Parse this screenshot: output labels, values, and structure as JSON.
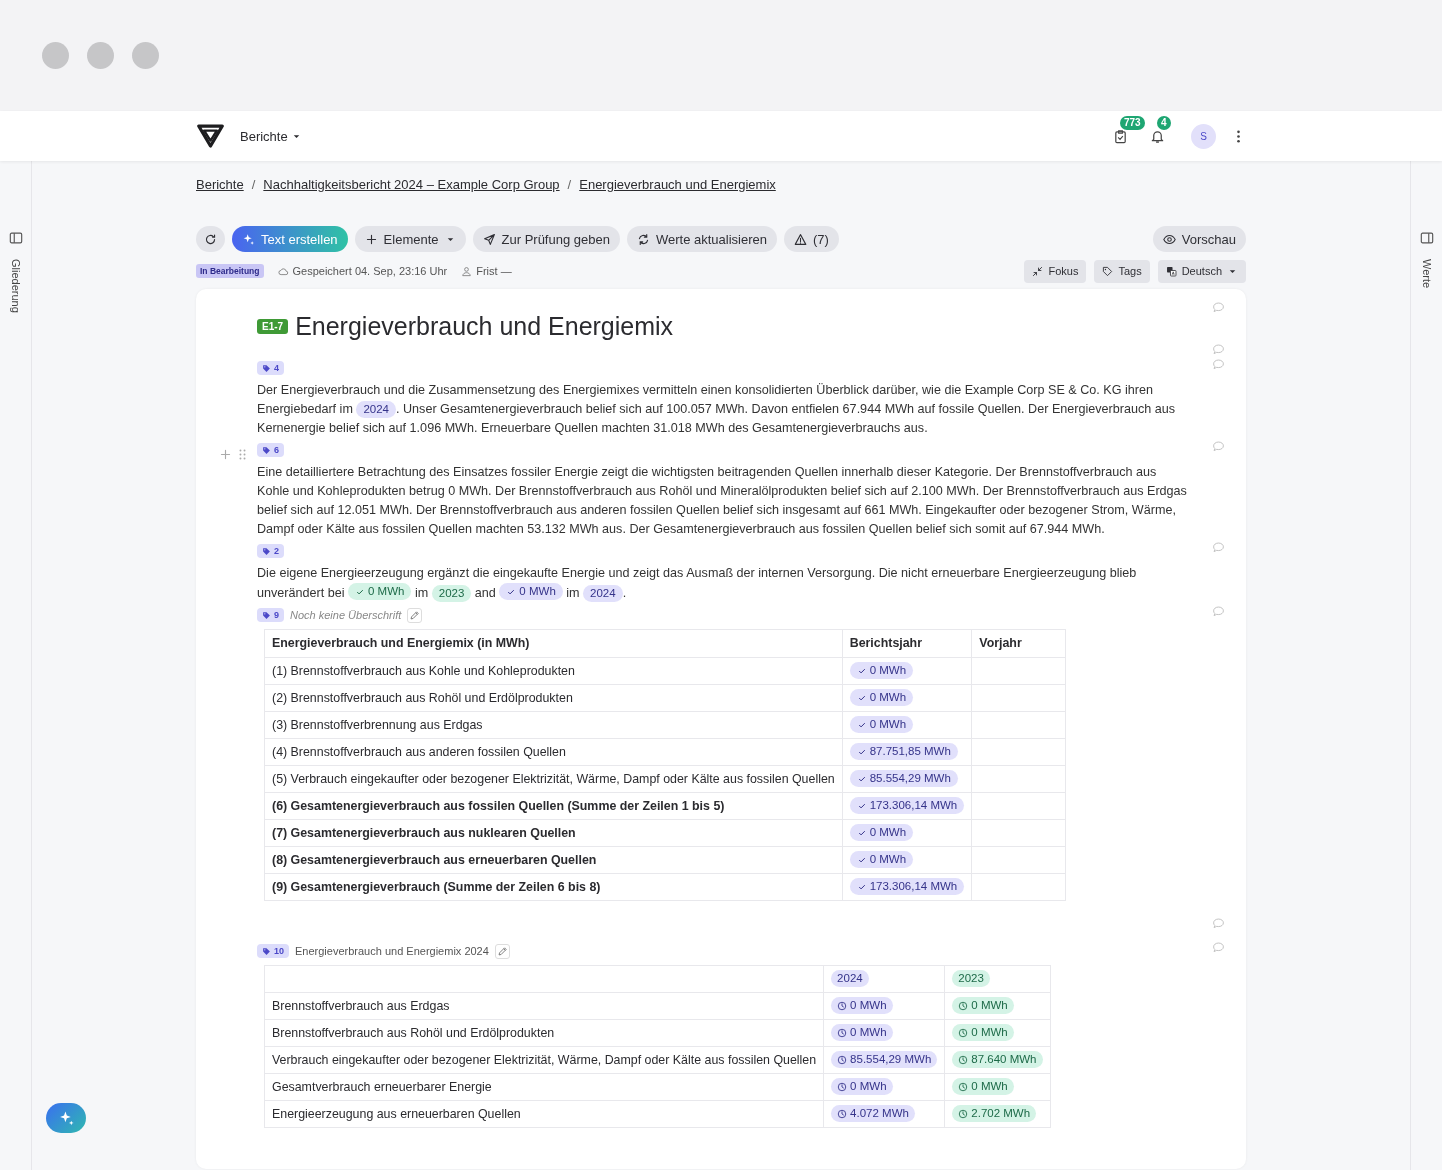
{
  "topbar": {
    "section": "Berichte",
    "tasks_count": "773",
    "notifications_count": "4",
    "avatar": "S"
  },
  "breadcrumb": {
    "separator": "/",
    "items": [
      "Berichte",
      "Nachhaltigkeitsbericht 2024 – Example Corp Group",
      "Energieverbrauch und Energiemix"
    ]
  },
  "toolbar": [
    {
      "kind": "reload"
    },
    {
      "kind": "primary",
      "label": "Text erstellen"
    },
    {
      "kind": "menu",
      "label": "Elemente"
    },
    {
      "kind": "submit",
      "label": "Zur Prüfung geben"
    },
    {
      "kind": "refresh",
      "label": "Werte aktualisieren"
    },
    {
      "kind": "warnings",
      "label": "(7)"
    }
  ],
  "preview": {
    "label": "Vorschau"
  },
  "status": {
    "label": "In Bearbeitung",
    "saved": "Gespeichert 04. Sep, 23:16 Uhr",
    "deadline": "Frist —"
  },
  "view_buttons": [
    {
      "kind": "focus",
      "label": "Fokus"
    },
    {
      "kind": "tags",
      "label": "Tags"
    },
    {
      "kind": "language",
      "label": "Deutsch"
    }
  ],
  "rails": {
    "left": "Gliederung",
    "right": "Werte"
  },
  "blocks": [
    {
      "kind": "heading",
      "code": "E1-7",
      "title": "Energieverbrauch und Energiemix"
    },
    {
      "kind": "paragraph",
      "tag": "4",
      "handles": false,
      "segments": [
        {
          "kind": "text",
          "text": "Der Energieverbrauch und die Zusammensetzung des Energiemixes vermitteln einen konsolidierten Überblick darüber, wie die Example Corp SE & Co. KG ihren Energiebedarf im "
        },
        {
          "kind": "year",
          "text": "2024",
          "color": "#e1e0fb"
        },
        {
          "kind": "text",
          "text": ". Unser Gesamtenergieverbrauch belief sich auf 100.057 MWh. Davon entfielen 67.944 MWh auf fossile Quellen. Der Energieverbrauch aus Kernenergie belief sich auf 1.096 MWh. Erneuerbare Quellen machten 31.018 MWh des Gesamtenergieverbrauchs aus."
        }
      ]
    },
    {
      "kind": "paragraph",
      "tag": "6",
      "handles": true,
      "segments": [
        {
          "kind": "text",
          "text": "Eine detailliertere Betrachtung des Einsatzes fossiler Energie zeigt die wichtigsten beitragenden Quellen innerhalb dieser Kategorie. Der Brennstoffverbrauch aus Kohle und Kohleprodukten betrug 0 MWh. Der Brennstoffverbrauch aus Rohöl und Mineralölprodukten belief sich auf 2.100 MWh. Der Brennstoffverbrauch aus Erdgas belief sich auf 12.051 MWh. Der Brennstoffverbrauch aus anderen fossilen Quellen belief sich insgesamt auf 661 MWh. Eingekaufter oder bezogener Strom, Wärme, Dampf oder Kälte aus fossilen Quellen machten 53.132 MWh aus. Der Gesamtenergieverbrauch aus fossilen Quellen belief sich somit auf 67.944 MWh."
        }
      ]
    },
    {
      "kind": "paragraph",
      "tag": "2",
      "handles": false,
      "segments": [
        {
          "kind": "text",
          "text": "Die eigene Energieerzeugung ergänzt die eingekaufte Energie und zeigt das Ausmaß der internen Versorgung. Die nicht erneuerbare Energieerzeugung blieb unverändert bei "
        },
        {
          "kind": "value",
          "text": "0 MWh",
          "color": "#d4f3e6"
        },
        {
          "kind": "text",
          "text": " im "
        },
        {
          "kind": "year",
          "text": "2023",
          "color": "#d4f3e6"
        },
        {
          "kind": "text",
          "text": " and "
        },
        {
          "kind": "value",
          "text": "0 MWh",
          "color": "#e1e0fb"
        },
        {
          "kind": "text",
          "text": " im "
        },
        {
          "kind": "year",
          "text": "2024",
          "color": "#e1e0fb"
        },
        {
          "kind": "text",
          "text": "."
        }
      ]
    },
    {
      "kind": "table",
      "tag": "9",
      "caption": "Noch keine Überschrift",
      "caption_placeholder": true,
      "columns": [
        "Energieverbrauch und Energiemix (in MWh)",
        "Berichtsjahr",
        "Vorjahr"
      ],
      "rows": [
        {
          "label": "(1) Brennstoffverbrauch aus Kohle und Kohleprodukten",
          "emphasis": false,
          "value": "0 MWh"
        },
        {
          "label": "(2) Brennstoffverbrauch aus Rohöl und Erdölprodukten",
          "emphasis": false,
          "value": "0 MWh"
        },
        {
          "label": "(3) Brennstoffverbrennung aus Erdgas",
          "emphasis": false,
          "value": "0 MWh"
        },
        {
          "label": "(4) Brennstoffverbrauch aus anderen fossilen Quellen",
          "emphasis": false,
          "value": "87.751,85 MWh"
        },
        {
          "label": "(5) Verbrauch eingekaufter oder bezogener Elektrizität, Wärme, Dampf oder Kälte aus fossilen Quellen",
          "emphasis": false,
          "value": "85.554,29 MWh"
        },
        {
          "label": "(6) Gesamtenergieverbrauch aus fossilen Quellen (Summe der Zeilen 1 bis 5)",
          "emphasis": true,
          "value": "173.306,14 MWh"
        },
        {
          "label": "(7) Gesamtenergieverbrauch aus nuklearen Quellen",
          "emphasis": true,
          "value": "0 MWh"
        },
        {
          "label": "(8) Gesamtenergieverbrauch aus erneuerbaren Quellen",
          "emphasis": true,
          "value": "0 MWh"
        },
        {
          "label": "(9) Gesamtenergieverbrauch (Summe der Zeilen 6 bis 8)",
          "emphasis": true,
          "value": "173.306,14 MWh"
        }
      ]
    },
    {
      "kind": "empty"
    },
    {
      "kind": "year_table",
      "tag": "10",
      "caption": "Energieverbrauch und Energiemix 2024",
      "caption_placeholder": false,
      "columns": [
        {
          "label": "2024",
          "color": "#e1e0fb"
        },
        {
          "label": "2023",
          "color": "#d4f3e6"
        }
      ],
      "rows": [
        {
          "label": "Brennstoffverbrauch aus Erdgas",
          "values": [
            "0 MWh",
            "0 MWh"
          ]
        },
        {
          "label": "Brennstoffverbrauch aus Rohöl und Erdölprodukten",
          "values": [
            "0 MWh",
            "0 MWh"
          ]
        },
        {
          "label": "Verbrauch eingekaufter oder bezogener Elektrizität, Wärme, Dampf oder Kälte aus fossilen Quellen",
          "values": [
            "85.554,29 MWh",
            "87.640 MWh"
          ]
        },
        {
          "label": "Gesamtverbrauch erneuerbarer Energie",
          "values": [
            "0 MWh",
            "0 MWh"
          ]
        },
        {
          "label": "Energieerzeugung aus erneuerbaren Quellen",
          "values": [
            "4.072 MWh",
            "2.702 MWh"
          ]
        }
      ]
    }
  ]
}
